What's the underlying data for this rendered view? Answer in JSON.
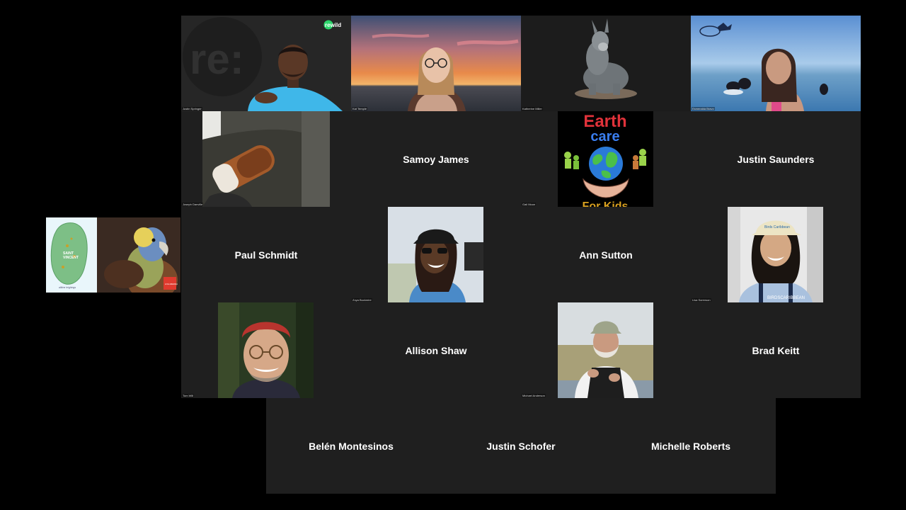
{
  "share": {
    "map_text_line1": "SAINT",
    "map_text_line2": "VINCENT",
    "map_caption": "ailbhe leighings",
    "badge": "LIVE AMERICA"
  },
  "participants": [
    {
      "name": "Justin Springer",
      "logo_text": "rewild",
      "logo_mark": "re:"
    },
    {
      "name": "Kat Temple"
    },
    {
      "name": "Katherine Miller"
    },
    {
      "name": "Esmeralda Bravo"
    },
    {
      "name": "Joseph Danville"
    },
    {
      "name": "Samoy James"
    },
    {
      "name": "Gail Moon",
      "poster_line1": "Earth",
      "poster_line2": "care",
      "poster_line3": "For Kids"
    },
    {
      "name": "Justin Saunders"
    },
    {
      "name": "Paul Schmidt"
    },
    {
      "name": "Zoya Buckmire"
    },
    {
      "name": "Ann Sutton"
    },
    {
      "name": "Lisa Sorenson",
      "cap_text": "Birds Caribbean",
      "shirt_text": "BIRDSCARIBBEAN"
    },
    {
      "name": "Tom Will"
    },
    {
      "name": "Allison Shaw"
    },
    {
      "name": "Michael Anderson"
    },
    {
      "name": "Brad Keitt"
    },
    {
      "name": "Belén Montesinos"
    },
    {
      "name": "Justin Schofer"
    },
    {
      "name": "Michelle Roberts"
    }
  ],
  "colors": {
    "tile_bg": "#1f1f1f",
    "page_bg": "#000000",
    "name_text": "#ffffff",
    "rewild_green": "#2bd66b",
    "shirt_blue": "#3fb7e9"
  }
}
